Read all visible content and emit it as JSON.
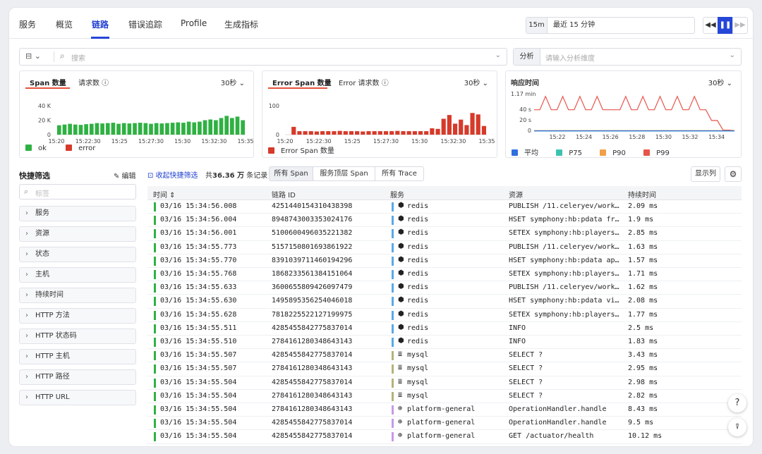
{
  "nav": {
    "tabs": [
      "服务",
      "概览",
      "链路",
      "错误追踪",
      "Profile",
      "生成指标"
    ],
    "active": "链路"
  },
  "time": {
    "short": "15m",
    "long": "最近 15 分钟"
  },
  "search": {
    "placeholder": "搜索",
    "analyze_label": "分析",
    "analyze_placeholder": "请输入分析维度"
  },
  "charts": {
    "span": {
      "tab1": "Span 数量",
      "tab2": "请求数 ⓘ",
      "interval": "30秒 ⌄",
      "legend": [
        "ok",
        "error"
      ]
    },
    "error": {
      "tab1": "Error Span 数量",
      "tab2": "Error 请求数 ⓘ",
      "interval": "30秒 ⌄",
      "legend": [
        "Error Span 数量"
      ]
    },
    "resp": {
      "title": "响应时间",
      "interval": "30秒 ⌄",
      "legend": [
        "平均",
        "P75",
        "P90",
        "P99"
      ]
    }
  },
  "chart_data": [
    {
      "type": "bar",
      "ylim": [
        0,
        40000
      ],
      "yticks": [
        "40 K",
        "20 K",
        "0"
      ],
      "xticks": [
        "15:20",
        "15:22:30",
        "15:25",
        "15:27:30",
        "15:30",
        "15:32:30",
        "15:35"
      ],
      "series": [
        {
          "name": "ok",
          "values": [
            13000,
            14000,
            15000,
            14000,
            13500,
            14500,
            15000,
            16000,
            15500,
            16000,
            16500,
            15000,
            16000,
            15500,
            16000,
            16500,
            16000,
            15000,
            16000,
            15500,
            16000,
            16500,
            17000,
            16500,
            18000,
            17000,
            18000,
            20000,
            21000,
            20000,
            23000,
            26000,
            23000,
            25000,
            20000
          ]
        },
        {
          "name": "error",
          "values": [
            0,
            0,
            0,
            0,
            0,
            0,
            0,
            0,
            0,
            0,
            0,
            0,
            0,
            0,
            0,
            0,
            0,
            0,
            0,
            0,
            0,
            0,
            0,
            0,
            0,
            0,
            0,
            0,
            0,
            0,
            0,
            0,
            0,
            0,
            0
          ]
        }
      ],
      "colors": {
        "ok": "#2fb142",
        "error": "#d63a2a"
      }
    },
    {
      "type": "bar",
      "ylim": [
        0,
        100
      ],
      "yticks": [
        "100",
        "0"
      ],
      "xticks": [
        "15:20",
        "15:22:30",
        "15:25",
        "15:27:30",
        "15:30",
        "15:32:30",
        "15:35"
      ],
      "series": [
        {
          "name": "Error Span 数量",
          "values": [
            0,
            27,
            12,
            12,
            12,
            11,
            12,
            12,
            12,
            13,
            12,
            12,
            12,
            11,
            12,
            12,
            12,
            12,
            12,
            13,
            12,
            12,
            12,
            12,
            12,
            22,
            20,
            55,
            68,
            38,
            52,
            33,
            75,
            70,
            30
          ]
        }
      ],
      "colors": {
        "Error Span 数量": "#d63a2a"
      }
    },
    {
      "type": "line",
      "yticks": [
        "1.17 min",
        "40 s",
        "20 s",
        "0"
      ],
      "ylim": [
        0,
        70
      ],
      "xticks": [
        "15:22",
        "15:24",
        "15:26",
        "15:28",
        "15:30",
        "15:32",
        "15:34"
      ],
      "series": [
        {
          "name": "P99",
          "values": [
            40,
            40,
            65,
            40,
            40,
            65,
            40,
            40,
            65,
            40,
            40,
            65,
            40,
            40,
            40,
            40,
            65,
            40,
            40,
            65,
            40,
            40,
            65,
            40,
            40,
            65,
            40,
            40,
            65,
            40,
            40,
            20,
            20,
            2,
            2,
            1
          ]
        },
        {
          "name": "P90",
          "values": [
            1,
            1,
            1,
            1,
            1,
            1,
            1,
            1,
            1,
            1,
            1,
            1,
            1,
            1,
            1,
            1,
            1,
            1,
            1,
            1,
            1,
            1,
            1,
            1,
            1,
            1,
            1,
            1,
            1,
            1,
            1,
            1,
            1,
            1,
            1,
            1
          ]
        },
        {
          "name": "P75",
          "values": [
            0.3,
            0.3,
            0.3,
            0.3,
            0.3,
            0.3,
            0.3,
            0.3,
            0.3,
            0.3,
            0.3,
            0.3,
            0.3,
            0.3,
            0.3,
            0.3,
            0.3,
            0.3,
            0.3,
            0.3,
            0.3,
            0.3,
            0.3,
            0.3,
            0.3,
            0.3,
            0.3,
            0.3,
            0.3,
            0.3,
            0.3,
            0.3,
            0.3,
            0.3,
            0.3,
            0.3
          ]
        },
        {
          "name": "平均",
          "values": [
            0.5,
            0.5,
            0.5,
            0.5,
            0.5,
            0.5,
            0.5,
            0.5,
            0.5,
            0.5,
            0.5,
            0.5,
            0.5,
            0.5,
            0.5,
            0.5,
            0.5,
            0.5,
            0.5,
            0.5,
            0.5,
            0.5,
            0.5,
            0.5,
            0.5,
            0.5,
            0.5,
            0.5,
            0.5,
            0.5,
            0.5,
            0.5,
            0.5,
            0.5,
            0.5,
            0.5
          ]
        }
      ],
      "colors": {
        "P99": "#e8534a",
        "P90": "#f0a04a",
        "P75": "#3cc2b0",
        "平均": "#2f6fe0"
      }
    }
  ],
  "quick_filter": {
    "title": "快捷筛选",
    "edit": "✎ 编辑",
    "search_placeholder": "标签",
    "items": [
      "服务",
      "资源",
      "状态",
      "主机",
      "持续时间",
      "HTTP 方法",
      "HTTP 状态码",
      "HTTP 主机",
      "HTTP 路径",
      "HTTP URL"
    ]
  },
  "toolbar": {
    "collapse": "收起快捷筛选",
    "count_prefix": "共",
    "count_value": "36.36 万",
    "count_suffix": " 条记录",
    "segments": [
      "所有 Span",
      "服务顶层 Span",
      "所有 Trace"
    ],
    "columns_btn": "显示列"
  },
  "table": {
    "headers": [
      "时间 ⇕",
      "链路 ID",
      "服务",
      "资源",
      "持续时间"
    ],
    "rows": [
      {
        "time": "03/16 15:34:56.008",
        "id": "4251440154310438398",
        "svc": "redis",
        "svc_kind": "redis",
        "res": "PUBLISH /11.celeryev/work…",
        "dur": "2.09 ms"
      },
      {
        "time": "03/16 15:34:56.004",
        "id": "8948743003353024176",
        "svc": "redis",
        "svc_kind": "redis",
        "res": "HSET symphony:hb:pdata fr…",
        "dur": "1.9 ms"
      },
      {
        "time": "03/16 15:34:56.001",
        "id": "5100600496035221382",
        "svc": "redis",
        "svc_kind": "redis",
        "res": "SETEX symphony:hb:players…",
        "dur": "2.85 ms"
      },
      {
        "time": "03/16 15:34:55.773",
        "id": "5157150801693861922",
        "svc": "redis",
        "svc_kind": "redis",
        "res": "PUBLISH /11.celeryev/work…",
        "dur": "1.63 ms"
      },
      {
        "time": "03/16 15:34:55.770",
        "id": "8391039711460194296",
        "svc": "redis",
        "svc_kind": "redis",
        "res": "HSET symphony:hb:pdata ap…",
        "dur": "1.57 ms"
      },
      {
        "time": "03/16 15:34:55.768",
        "id": "1868233561384151064",
        "svc": "redis",
        "svc_kind": "redis",
        "res": "SETEX symphony:hb:players…",
        "dur": "1.71 ms"
      },
      {
        "time": "03/16 15:34:55.633",
        "id": "3600655809426097479",
        "svc": "redis",
        "svc_kind": "redis",
        "res": "PUBLISH /11.celeryev/work…",
        "dur": "1.62 ms"
      },
      {
        "time": "03/16 15:34:55.630",
        "id": "1495895356254046018",
        "svc": "redis",
        "svc_kind": "redis",
        "res": "HSET symphony:hb:pdata vi…",
        "dur": "2.08 ms"
      },
      {
        "time": "03/16 15:34:55.628",
        "id": "7818225522127199975",
        "svc": "redis",
        "svc_kind": "redis",
        "res": "SETEX symphony:hb:players…",
        "dur": "1.77 ms"
      },
      {
        "time": "03/16 15:34:55.511",
        "id": "4285455842775837014",
        "svc": "redis",
        "svc_kind": "redis",
        "res": "INFO",
        "dur": "2.5 ms"
      },
      {
        "time": "03/16 15:34:55.510",
        "id": "2784161280348643143",
        "svc": "redis",
        "svc_kind": "redis",
        "res": "INFO",
        "dur": "1.83 ms"
      },
      {
        "time": "03/16 15:34:55.507",
        "id": "4285455842775837014",
        "svc": "mysql",
        "svc_kind": "mysql",
        "res": "SELECT ?",
        "dur": "3.43 ms"
      },
      {
        "time": "03/16 15:34:55.507",
        "id": "2784161280348643143",
        "svc": "mysql",
        "svc_kind": "mysql",
        "res": "SELECT ?",
        "dur": "2.95 ms"
      },
      {
        "time": "03/16 15:34:55.504",
        "id": "4285455842775837014",
        "svc": "mysql",
        "svc_kind": "mysql",
        "res": "SELECT ?",
        "dur": "2.98 ms"
      },
      {
        "time": "03/16 15:34:55.504",
        "id": "2784161280348643143",
        "svc": "mysql",
        "svc_kind": "mysql",
        "res": "SELECT ?",
        "dur": "2.82 ms"
      },
      {
        "time": "03/16 15:34:55.504",
        "id": "2784161280348643143",
        "svc": "platform-general",
        "svc_kind": "web",
        "res": "OperationHandler.handle",
        "dur": "8.43 ms"
      },
      {
        "time": "03/16 15:34:55.504",
        "id": "4285455842775837014",
        "svc": "platform-general",
        "svc_kind": "web",
        "res": "OperationHandler.handle",
        "dur": "9.5 ms"
      },
      {
        "time": "03/16 15:34:55.504",
        "id": "4285455842775837014",
        "svc": "platform-general",
        "svc_kind": "web",
        "res": "GET /actuator/health",
        "dur": "10.12 ms"
      }
    ]
  },
  "svc_colors": {
    "redis": "#5aa8e8",
    "mysql": "#b5b27a",
    "web": "#c59ae8"
  },
  "svc_icons": {
    "redis": "⬢",
    "mysql": "≣",
    "web": "⊕"
  },
  "float": {
    "help": "?",
    "filter": "⍒"
  }
}
